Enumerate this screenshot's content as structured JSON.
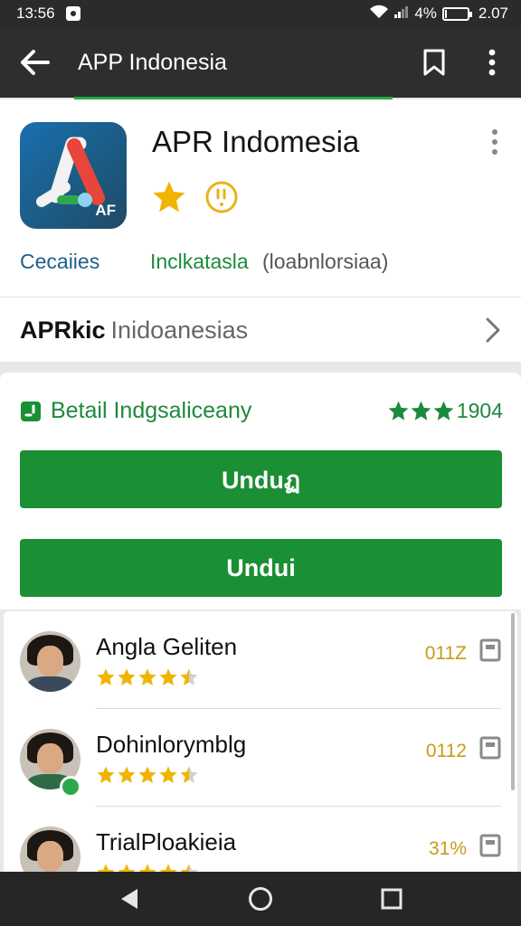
{
  "status_bar": {
    "time": "13:56",
    "battery_text": "4%",
    "battery_level": 0.04,
    "clock_right": "2.07"
  },
  "app_bar": {
    "title": "APP Indonesia",
    "back_icon": "arrow-left-icon",
    "bookmark_icon": "bookmark-icon",
    "overflow_icon": "more-vert-icon"
  },
  "app_header": {
    "name": "APR Indomesia",
    "icon_label": "AF",
    "developer": "Cecaiies",
    "category": "Inclkatasla",
    "category_sub": "(loabnlorsiaa)",
    "overflow_icon": "more-vert-icon",
    "rating_icons": [
      "star-icon",
      "clock-icon"
    ]
  },
  "section_link": {
    "bold": "APRkic",
    "light": "Inidoanesias"
  },
  "details": {
    "title": "Betail Indgsaliceany",
    "score_text": "1904",
    "score_stars": 3
  },
  "buttons": {
    "primary_label": "Unduฏ",
    "secondary_label": "Undui"
  },
  "reviews": [
    {
      "name": "Angla Geliten",
      "stars": 4.5,
      "score": "011Z",
      "badge": false
    },
    {
      "name": "Dohinlorymblg",
      "stars": 4.5,
      "score": "0112",
      "badge": true
    },
    {
      "name": "TrialPloakieia",
      "stars": 4.5,
      "score": "31%",
      "badge": false
    }
  ],
  "colors": {
    "accent_green": "#1a8f33",
    "star_yellow": "#f0b400",
    "app_bar": "#2e2e2e"
  }
}
